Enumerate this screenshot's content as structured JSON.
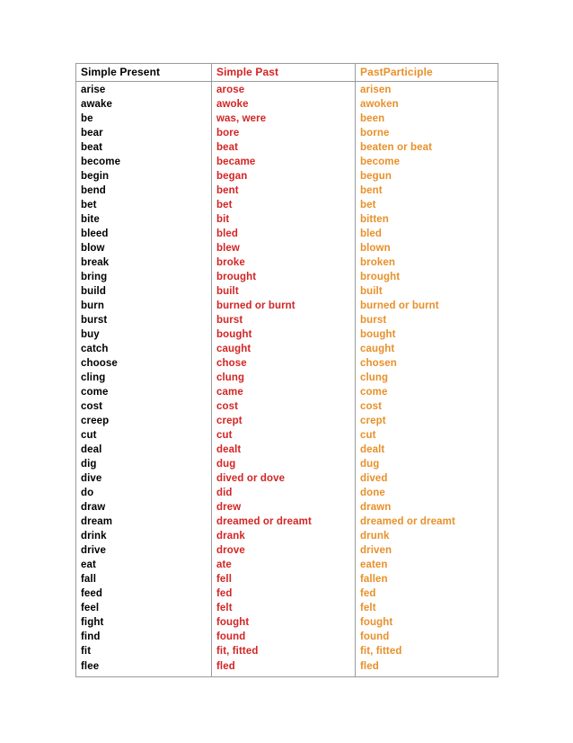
{
  "table": {
    "name": "irregular-verbs-table",
    "colors": {
      "present": "#000000",
      "past": "#d42424",
      "participle": "#e8902a",
      "border": "#9a9a9a",
      "background": "#ffffff"
    },
    "headers": [
      "Simple Present",
      "Simple Past",
      "PastParticiple"
    ],
    "rows": [
      [
        "arise",
        "arose",
        "arisen"
      ],
      [
        "awake",
        "awoke",
        "awoken"
      ],
      [
        "be",
        "was, were",
        "been"
      ],
      [
        "bear",
        "bore",
        "borne"
      ],
      [
        "beat",
        "beat",
        "beaten or beat"
      ],
      [
        "become",
        "became",
        "become"
      ],
      [
        "begin",
        "began",
        "begun"
      ],
      [
        "bend",
        "bent",
        "bent"
      ],
      [
        "bet",
        "bet",
        "bet"
      ],
      [
        "bite",
        "bit",
        "bitten"
      ],
      [
        "bleed",
        "bled",
        "bled"
      ],
      [
        "blow",
        "blew",
        "blown"
      ],
      [
        "break",
        "broke",
        "broken"
      ],
      [
        "bring",
        "brought",
        "brought"
      ],
      [
        "build",
        "built",
        "built"
      ],
      [
        "burn",
        "burned or burnt",
        "burned or burnt"
      ],
      [
        "burst",
        "burst",
        "burst"
      ],
      [
        "buy",
        "bought",
        "bought"
      ],
      [
        "catch",
        "caught",
        "caught"
      ],
      [
        "choose",
        "chose",
        "chosen"
      ],
      [
        "cling",
        "clung",
        "clung"
      ],
      [
        "come",
        "came",
        "come"
      ],
      [
        "cost",
        "cost",
        "cost"
      ],
      [
        "creep",
        "crept",
        "crept"
      ],
      [
        "cut",
        "cut",
        "cut"
      ],
      [
        "deal",
        "dealt",
        "dealt"
      ],
      [
        "dig",
        "dug",
        "dug"
      ],
      [
        "dive",
        "dived or dove",
        "dived"
      ],
      [
        "do",
        "did",
        "done"
      ],
      [
        "draw",
        "drew",
        "drawn"
      ],
      [
        "dream",
        "dreamed or dreamt",
        "dreamed or dreamt"
      ],
      [
        "drink",
        "drank",
        "drunk"
      ],
      [
        "drive",
        "drove",
        "driven"
      ],
      [
        "eat",
        "ate",
        "eaten"
      ],
      [
        "fall",
        "fell",
        "fallen"
      ],
      [
        "feed",
        "fed",
        "fed"
      ],
      [
        "feel",
        "felt",
        "felt"
      ],
      [
        "fight",
        "fought",
        "fought"
      ],
      [
        "find",
        "found",
        "found"
      ],
      [
        "fit",
        "fit, fitted",
        "fit, fitted"
      ],
      [
        "flee",
        "fled",
        "fled"
      ]
    ]
  }
}
